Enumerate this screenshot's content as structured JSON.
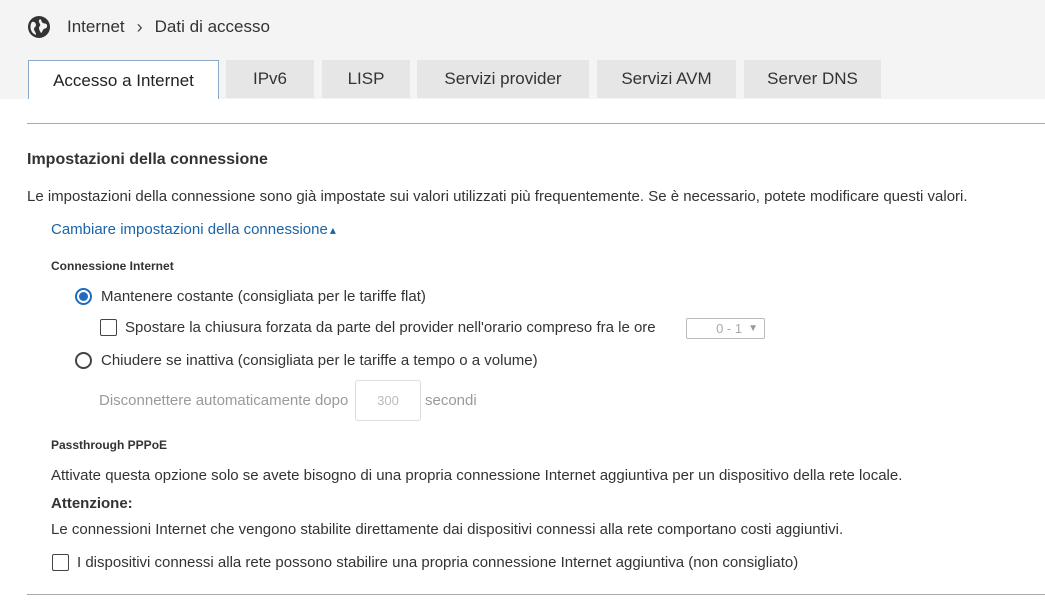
{
  "breadcrumb": {
    "root": "Internet",
    "separator": "›",
    "current": "Dati di accesso"
  },
  "tabs": [
    {
      "label": "Accesso a Internet",
      "active": true
    },
    {
      "label": "IPv6"
    },
    {
      "label": "LISP"
    },
    {
      "label": "Servizi provider"
    },
    {
      "label": "Servizi AVM"
    },
    {
      "label": "Server DNS"
    }
  ],
  "section": {
    "title": "Impostazioni della connessione",
    "description": "Le impostazioni della connessione sono già impostate sui valori utilizzati più frequentemente. Se è necessario, potete modificare questi valori.",
    "toggle_link": "Cambiare impostazioni della connessione",
    "toggle_arrow": "▴"
  },
  "connection": {
    "heading": "Connessione Internet",
    "option_keep": "Mantenere costante (consigliata per le tariffe flat)",
    "option_keep_checked": true,
    "shift_label": "Spostare la chiusura forzata da parte del provider nell'orario compreso fra le ore",
    "shift_checked": false,
    "shift_value": "0 - 1",
    "option_idle": "Chiudere se inattiva (consigliata per le tariffe a tempo o a volume)",
    "option_idle_checked": false,
    "auto_disconnect_label": "Disconnettere automaticamente dopo",
    "auto_disconnect_value": "300",
    "auto_disconnect_unit": "secondi"
  },
  "pppoe": {
    "heading": "Passthrough PPPoE",
    "info": "Attivate questa opzione solo se avete bisogno di una propria connessione Internet aggiuntiva per un dispositivo della rete locale.",
    "warning_label": "Attenzione:",
    "warning_text": "Le connessioni Internet che vengono stabilite direttamente dai dispositivi connessi alla rete comportano costi aggiuntivi.",
    "allow_label": "I dispositivi connessi alla rete possono stabilire una propria connessione Internet aggiuntiva (non consigliato)",
    "allow_checked": false
  },
  "colors": {
    "accent": "#1f6cc0",
    "link": "#1a64a8",
    "tab_bg": "#e6e6e6"
  }
}
